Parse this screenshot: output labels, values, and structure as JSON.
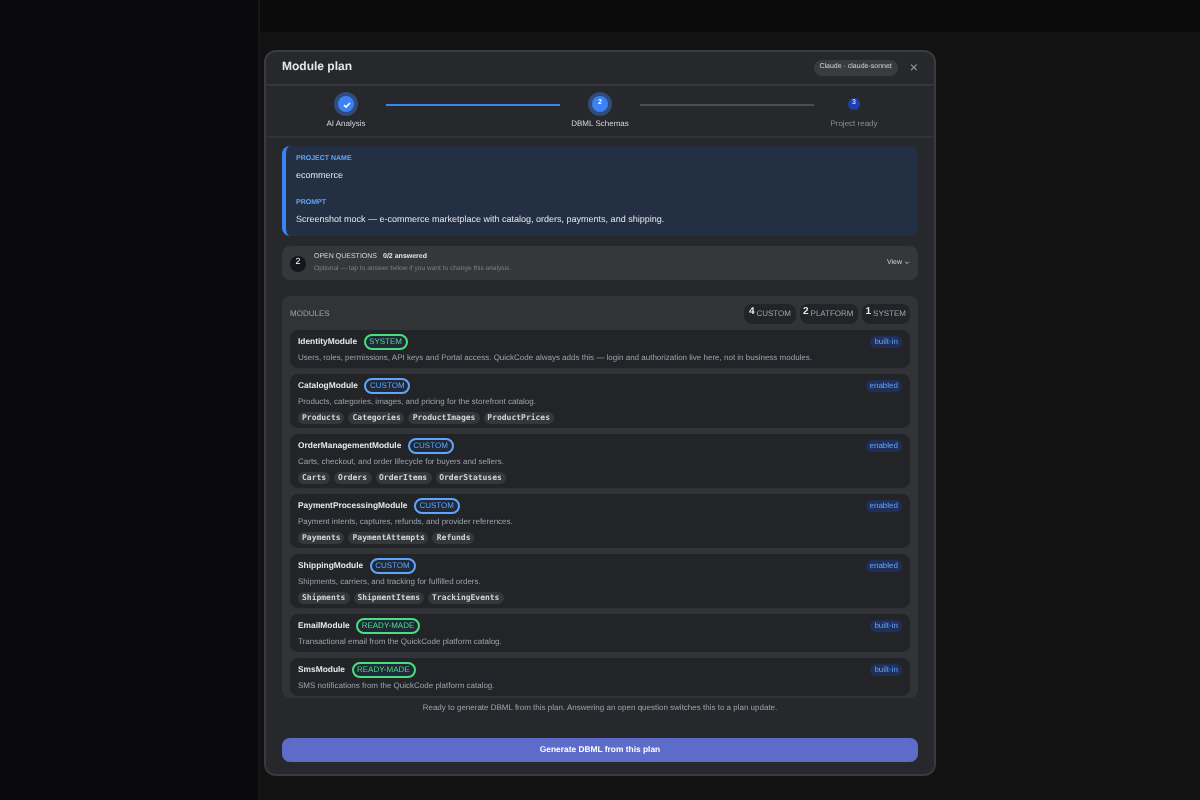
{
  "modal": {
    "title": "Module plan",
    "model_badge": "Claude · claude-sonnet",
    "close": "×"
  },
  "steps": [
    {
      "label": "AI Analysis",
      "completed": true,
      "selected": false
    },
    {
      "label": "DBML Schemas",
      "number": "2",
      "completed": false,
      "selected": true
    },
    {
      "label": "Project ready",
      "number": "3",
      "completed": false,
      "selected": false
    }
  ],
  "project": {
    "name_label": "PROJECT NAME",
    "name": "ecommerce",
    "prompt_label": "PROMPT",
    "prompt": "Screenshot mock — e-commerce marketplace with catalog, orders, payments, and shipping."
  },
  "open_questions": {
    "count": "2",
    "title": "OPEN QUESTIONS",
    "answered": "0/2 answered",
    "hint": "Optional — tap to answer below if you want to change this analysis.",
    "view": "View"
  },
  "modules": {
    "heading": "MODULES",
    "counts": [
      {
        "number": "4",
        "label": "CUSTOM"
      },
      {
        "number": "2",
        "label": "PLATFORM"
      },
      {
        "number": "1",
        "label": "SYSTEM"
      }
    ],
    "items": [
      {
        "name": "IdentityModule",
        "tag": "SYSTEM",
        "color": "#4ade80",
        "status": "built-in",
        "description": "Users, roles, permissions, API keys and Portal access. QuickCode always adds this — login and authorization live here, not in business modules."
      },
      {
        "name": "CatalogModule",
        "tag": "CUSTOM",
        "color": "#60a5fa",
        "status": "enabled",
        "description": "Products, categories, images, and pricing for the storefront catalog.",
        "entities": [
          "Products",
          "Categories",
          "ProductImages",
          "ProductPrices"
        ]
      },
      {
        "name": "OrderManagementModule",
        "tag": "CUSTOM",
        "color": "#60a5fa",
        "status": "enabled",
        "description": "Carts, checkout, and order lifecycle for buyers and sellers.",
        "entities": [
          "Carts",
          "Orders",
          "OrderItems",
          "OrderStatuses"
        ]
      },
      {
        "name": "PaymentProcessingModule",
        "tag": "CUSTOM",
        "color": "#60a5fa",
        "status": "enabled",
        "description": "Payment intents, captures, refunds, and provider references.",
        "entities": [
          "Payments",
          "PaymentAttempts",
          "Refunds"
        ]
      },
      {
        "name": "ShippingModule",
        "tag": "CUSTOM",
        "color": "#60a5fa",
        "status": "enabled",
        "description": "Shipments, carriers, and tracking for fulfilled orders.",
        "entities": [
          "Shipments",
          "ShipmentItems",
          "TrackingEvents"
        ]
      },
      {
        "name": "EmailModule",
        "tag": "READY-MADE",
        "color": "#4ade80",
        "status": "built-in",
        "description": "Transactional email from the QuickCode platform catalog."
      },
      {
        "name": "SmsModule",
        "tag": "READY-MADE",
        "color": "#4ade80",
        "status": "built-in",
        "description": "SMS notifications from the QuickCode platform catalog."
      }
    ]
  },
  "footer": {
    "note": "Ready to generate DBML from this plan. Answering an open question switches this to a plan update.",
    "button": "Generate DBML from this plan"
  }
}
